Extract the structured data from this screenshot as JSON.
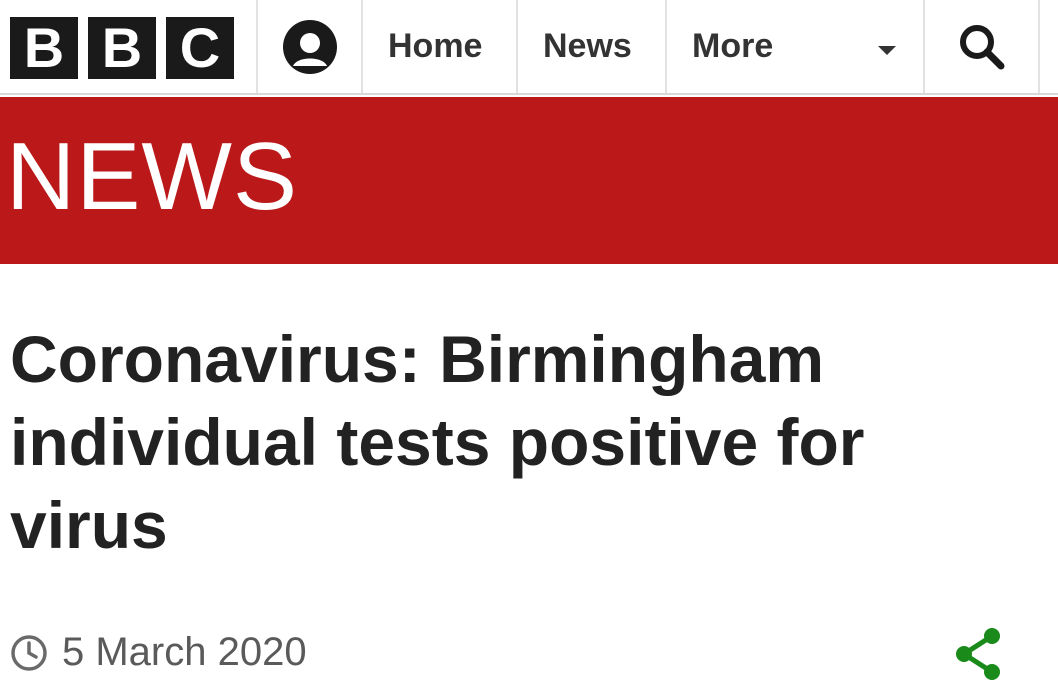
{
  "header": {
    "logo_letters": [
      "B",
      "B",
      "C"
    ],
    "nav": {
      "home_label": "Home",
      "news_label": "News",
      "more_label": "More"
    }
  },
  "banner": {
    "title": "NEWS",
    "color": "#bb1919"
  },
  "article": {
    "headline": "Coronavirus: Birmingham individual tests positive for virus",
    "date": "5 March 2020"
  },
  "icons": {
    "account": "account-icon",
    "dropdown": "chevron-down-icon",
    "search": "search-icon",
    "clock": "clock-icon",
    "share": "share-icon"
  },
  "colors": {
    "share_green": "#1a8a1a",
    "text_dark": "#222222",
    "text_muted": "#5a5a5a"
  }
}
